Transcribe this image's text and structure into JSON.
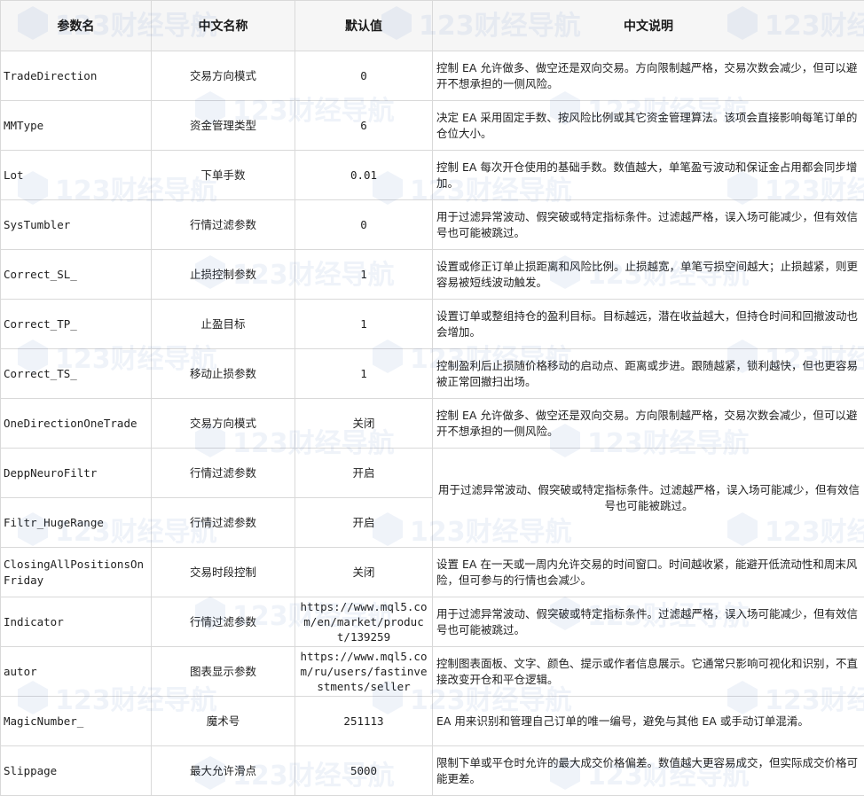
{
  "table": {
    "headers": [
      "参数名",
      "中文名称",
      "默认值",
      "中文说明"
    ],
    "rows": [
      {
        "param": "TradeDirection",
        "name": "交易方向模式",
        "default": "0",
        "desc": "控制 EA 允许做多、做空还是双向交易。方向限制越严格，交易次数会减少，但可以避开不想承担的一侧风险。"
      },
      {
        "param": "MMType",
        "name": "资金管理类型",
        "default": "6",
        "desc": "决定 EA 采用固定手数、按风险比例或其它资金管理算法。该项会直接影响每笔订单的仓位大小。"
      },
      {
        "param": "Lot",
        "name": "下单手数",
        "default": "0.01",
        "desc": "控制 EA 每次开仓使用的基础手数。数值越大，单笔盈亏波动和保证金占用都会同步增加。"
      },
      {
        "param": "SysTumbler",
        "name": "行情过滤参数",
        "default": "0",
        "desc": "用于过滤异常波动、假突破或特定指标条件。过滤越严格，误入场可能减少，但有效信号也可能被跳过。"
      },
      {
        "param": "Correct_SL_",
        "name": "止损控制参数",
        "default": "1",
        "desc": "设置或修正订单止损距离和风险比例。止损越宽，单笔亏损空间越大；止损越紧，则更容易被短线波动触发。"
      },
      {
        "param": "Correct_TP_",
        "name": "止盈目标",
        "default": "1",
        "desc": "设置订单或整组持仓的盈利目标。目标越远，潜在收益越大，但持仓时间和回撤波动也会增加。"
      },
      {
        "param": "Correct_TS_",
        "name": "移动止损参数",
        "default": "1",
        "desc": "控制盈利后止损随价格移动的启动点、距离或步进。跟随越紧，锁利越快，但也更容易被正常回撤扫出场。"
      },
      {
        "param": "OneDirectionOneTrade",
        "name": "交易方向模式",
        "default": "关闭",
        "desc": "控制 EA 允许做多、做空还是双向交易。方向限制越严格，交易次数会减少，但可以避开不想承担的一侧风险。"
      },
      {
        "param": "DeppNeuroFiltr",
        "name": "行情过滤参数",
        "default": "开启",
        "desc": "用于过滤异常波动、假突破或特定指标条件。过滤越严格，误入场可能减少，但有效信号也可能被跳过。"
      },
      {
        "param": "Filtr_HugeRange",
        "name": "行情过滤参数",
        "default": "开启"
      },
      {
        "param": "ClosingAllPositionsOnFriday",
        "name": "交易时段控制",
        "default": "关闭",
        "desc": "设置 EA 在一天或一周内允许交易的时间窗口。时间越收紧，能避开低流动性和周末风险，但可参与的行情也会减少。"
      },
      {
        "param": "Indicator",
        "name": "行情过滤参数",
        "default": "https://www.mql5.com/en/market/product/139259",
        "desc": "用于过滤异常波动、假突破或特定指标条件。过滤越严格，误入场可能减少，但有效信号也可能被跳过。"
      },
      {
        "param": "autor",
        "name": "图表显示参数",
        "default": "https://www.mql5.com/ru/users/fastinvestments/seller",
        "desc": "控制图表面板、文字、颜色、提示或作者信息展示。它通常只影响可视化和识别，不直接改变开仓和平仓逻辑。"
      },
      {
        "param": "MagicNumber_",
        "name": "魔术号",
        "default": "251113",
        "desc": "EA 用来识别和管理自己订单的唯一编号，避免与其他 EA 或手动订单混淆。"
      },
      {
        "param": "Slippage",
        "name": "最大允许滑点",
        "default": "5000",
        "desc": "限制下单或平仓时允许的最大成交价格偏差。数值越大更容易成交，但实际成交价格可能更差。"
      }
    ]
  },
  "watermark": {
    "text": "123财经导航",
    "color": "#2b5fb3"
  }
}
